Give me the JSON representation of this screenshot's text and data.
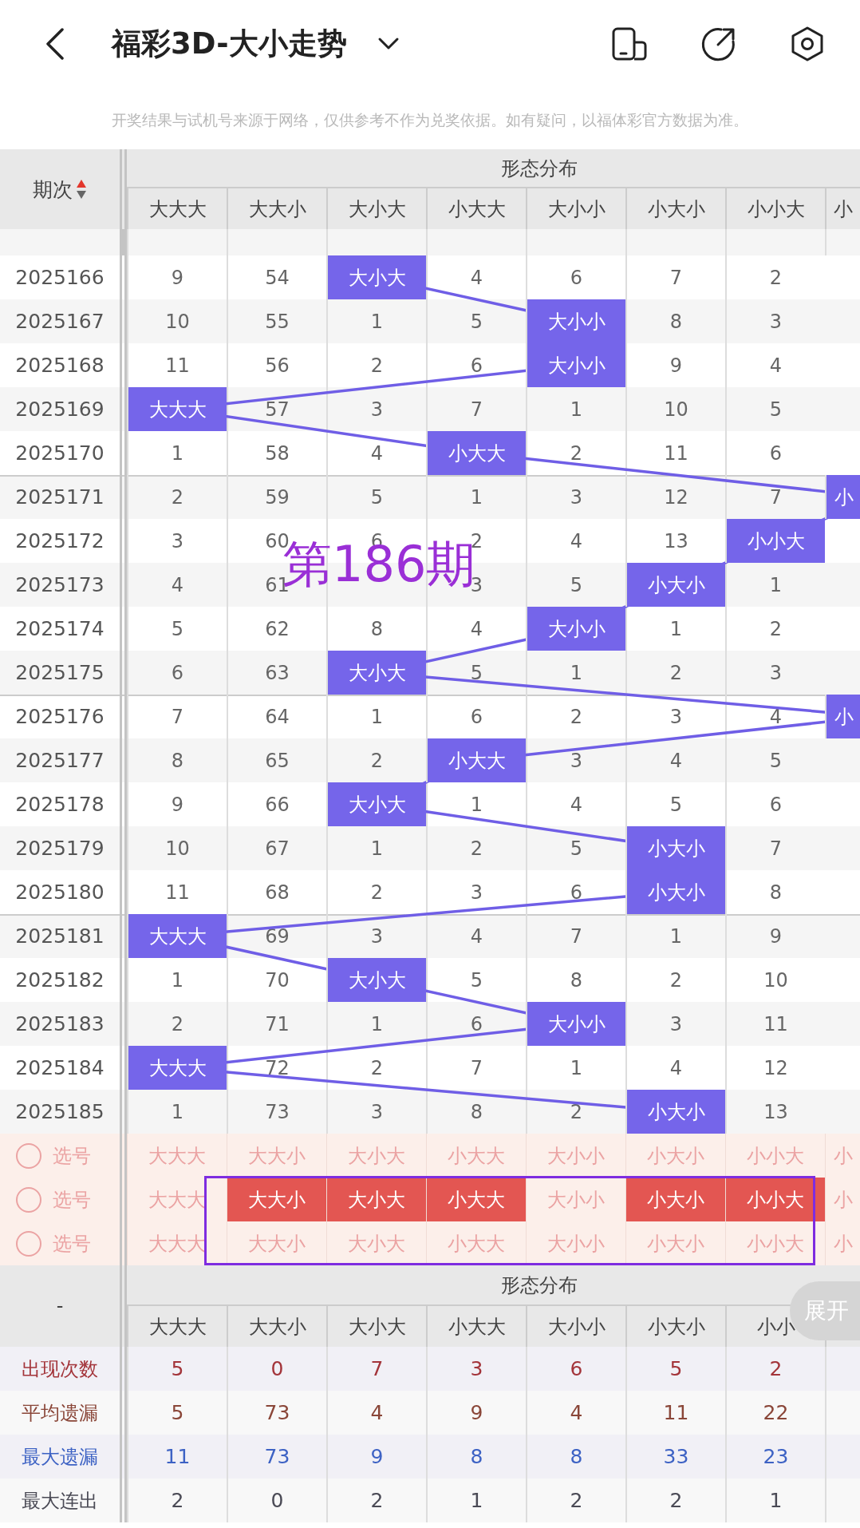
{
  "header": {
    "title": "福彩3D-大小走势"
  },
  "notice": "开奖结果与试机号来源于网络，仅供参考不作为兑奖依据。如有疑问，以福体彩官方数据为准。",
  "table": {
    "period_header": "期次",
    "group_header": "形态分布",
    "columns": [
      "大大大",
      "大大小",
      "大小大",
      "小大大",
      "大小小",
      "小大小",
      "小小大",
      "小"
    ],
    "rows": [
      {
        "period": "2025166",
        "cells": [
          {
            "text": "9",
            "hit": false
          },
          {
            "text": "54",
            "hit": false
          },
          {
            "text": "大小大",
            "hit": true
          },
          {
            "text": "4",
            "hit": false
          },
          {
            "text": "6",
            "hit": false
          },
          {
            "text": "7",
            "hit": false
          },
          {
            "text": "2",
            "hit": false
          }
        ]
      },
      {
        "period": "2025167",
        "cells": [
          {
            "text": "10",
            "hit": false
          },
          {
            "text": "55",
            "hit": false
          },
          {
            "text": "1",
            "hit": false
          },
          {
            "text": "5",
            "hit": false
          },
          {
            "text": "大小小",
            "hit": true
          },
          {
            "text": "8",
            "hit": false
          },
          {
            "text": "3",
            "hit": false
          }
        ]
      },
      {
        "period": "2025168",
        "cells": [
          {
            "text": "11",
            "hit": false
          },
          {
            "text": "56",
            "hit": false
          },
          {
            "text": "2",
            "hit": false
          },
          {
            "text": "6",
            "hit": false
          },
          {
            "text": "大小小",
            "hit": true
          },
          {
            "text": "9",
            "hit": false
          },
          {
            "text": "4",
            "hit": false
          }
        ]
      },
      {
        "period": "2025169",
        "cells": [
          {
            "text": "大大大",
            "hit": true
          },
          {
            "text": "57",
            "hit": false
          },
          {
            "text": "3",
            "hit": false
          },
          {
            "text": "7",
            "hit": false
          },
          {
            "text": "1",
            "hit": false
          },
          {
            "text": "10",
            "hit": false
          },
          {
            "text": "5",
            "hit": false
          }
        ]
      },
      {
        "period": "2025170",
        "cells": [
          {
            "text": "1",
            "hit": false
          },
          {
            "text": "58",
            "hit": false
          },
          {
            "text": "4",
            "hit": false
          },
          {
            "text": "小大大",
            "hit": true
          },
          {
            "text": "2",
            "hit": false
          },
          {
            "text": "11",
            "hit": false
          },
          {
            "text": "6",
            "hit": false
          }
        ]
      },
      {
        "period": "2025171",
        "cells": [
          {
            "text": "2",
            "hit": false
          },
          {
            "text": "59",
            "hit": false
          },
          {
            "text": "5",
            "hit": false
          },
          {
            "text": "1",
            "hit": false
          },
          {
            "text": "3",
            "hit": false
          },
          {
            "text": "12",
            "hit": false
          },
          {
            "text": "7",
            "hit": false
          },
          {
            "text": "小",
            "hit": true
          }
        ]
      },
      {
        "period": "2025172",
        "cells": [
          {
            "text": "3",
            "hit": false
          },
          {
            "text": "60",
            "hit": false
          },
          {
            "text": "6",
            "hit": false
          },
          {
            "text": "2",
            "hit": false
          },
          {
            "text": "4",
            "hit": false
          },
          {
            "text": "13",
            "hit": false
          },
          {
            "text": "小小大",
            "hit": true
          }
        ]
      },
      {
        "period": "2025173",
        "cells": [
          {
            "text": "4",
            "hit": false
          },
          {
            "text": "61",
            "hit": false
          },
          {
            "hit": false
          },
          {
            "text": "3",
            "hit": false
          },
          {
            "text": "5",
            "hit": false
          },
          {
            "text": "小大小",
            "hit": true
          },
          {
            "text": "1",
            "hit": false
          }
        ]
      },
      {
        "period": "2025174",
        "cells": [
          {
            "text": "5",
            "hit": false
          },
          {
            "text": "62",
            "hit": false
          },
          {
            "text": "8",
            "hit": false
          },
          {
            "text": "4",
            "hit": false
          },
          {
            "text": "大小小",
            "hit": true
          },
          {
            "text": "1",
            "hit": false
          },
          {
            "text": "2",
            "hit": false
          }
        ]
      },
      {
        "period": "2025175",
        "cells": [
          {
            "text": "6",
            "hit": false
          },
          {
            "text": "63",
            "hit": false
          },
          {
            "text": "大小大",
            "hit": true
          },
          {
            "text": "5",
            "hit": false
          },
          {
            "text": "1",
            "hit": false
          },
          {
            "text": "2",
            "hit": false
          },
          {
            "text": "3",
            "hit": false
          }
        ]
      },
      {
        "period": "2025176",
        "cells": [
          {
            "text": "7",
            "hit": false
          },
          {
            "text": "64",
            "hit": false
          },
          {
            "text": "1",
            "hit": false
          },
          {
            "text": "6",
            "hit": false
          },
          {
            "text": "2",
            "hit": false
          },
          {
            "text": "3",
            "hit": false
          },
          {
            "text": "4",
            "hit": false
          },
          {
            "text": "小",
            "hit": true
          }
        ]
      },
      {
        "period": "2025177",
        "cells": [
          {
            "text": "8",
            "hit": false
          },
          {
            "text": "65",
            "hit": false
          },
          {
            "text": "2",
            "hit": false
          },
          {
            "text": "小大大",
            "hit": true
          },
          {
            "text": "3",
            "hit": false
          },
          {
            "text": "4",
            "hit": false
          },
          {
            "text": "5",
            "hit": false
          }
        ]
      },
      {
        "period": "2025178",
        "cells": [
          {
            "text": "9",
            "hit": false
          },
          {
            "text": "66",
            "hit": false
          },
          {
            "text": "大小大",
            "hit": true
          },
          {
            "text": "1",
            "hit": false
          },
          {
            "text": "4",
            "hit": false
          },
          {
            "text": "5",
            "hit": false
          },
          {
            "text": "6",
            "hit": false
          }
        ]
      },
      {
        "period": "2025179",
        "cells": [
          {
            "text": "10",
            "hit": false
          },
          {
            "text": "67",
            "hit": false
          },
          {
            "text": "1",
            "hit": false
          },
          {
            "text": "2",
            "hit": false
          },
          {
            "text": "5",
            "hit": false
          },
          {
            "text": "小大小",
            "hit": true
          },
          {
            "text": "7",
            "hit": false
          }
        ]
      },
      {
        "period": "2025180",
        "cells": [
          {
            "text": "11",
            "hit": false
          },
          {
            "text": "68",
            "hit": false
          },
          {
            "text": "2",
            "hit": false
          },
          {
            "text": "3",
            "hit": false
          },
          {
            "text": "6",
            "hit": false
          },
          {
            "text": "小大小",
            "hit": true
          },
          {
            "text": "8",
            "hit": false
          }
        ]
      },
      {
        "period": "2025181",
        "cells": [
          {
            "text": "大大大",
            "hit": true
          },
          {
            "text": "69",
            "hit": false
          },
          {
            "text": "3",
            "hit": false
          },
          {
            "text": "4",
            "hit": false
          },
          {
            "text": "7",
            "hit": false
          },
          {
            "text": "1",
            "hit": false
          },
          {
            "text": "9",
            "hit": false
          }
        ]
      },
      {
        "period": "2025182",
        "cells": [
          {
            "text": "1",
            "hit": false
          },
          {
            "text": "70",
            "hit": false
          },
          {
            "text": "大小大",
            "hit": true
          },
          {
            "text": "5",
            "hit": false
          },
          {
            "text": "8",
            "hit": false
          },
          {
            "text": "2",
            "hit": false
          },
          {
            "text": "10",
            "hit": false
          }
        ]
      },
      {
        "period": "2025183",
        "cells": [
          {
            "text": "2",
            "hit": false
          },
          {
            "text": "71",
            "hit": false
          },
          {
            "text": "1",
            "hit": false
          },
          {
            "text": "6",
            "hit": false
          },
          {
            "text": "大小小",
            "hit": true
          },
          {
            "text": "3",
            "hit": false
          },
          {
            "text": "11",
            "hit": false
          }
        ]
      },
      {
        "period": "2025184",
        "cells": [
          {
            "text": "大大大",
            "hit": true
          },
          {
            "text": "72",
            "hit": false
          },
          {
            "text": "2",
            "hit": false
          },
          {
            "text": "7",
            "hit": false
          },
          {
            "text": "1",
            "hit": false
          },
          {
            "text": "4",
            "hit": false
          },
          {
            "text": "12",
            "hit": false
          }
        ]
      },
      {
        "period": "2025185",
        "cells": [
          {
            "text": "1",
            "hit": false
          },
          {
            "text": "73",
            "hit": false
          },
          {
            "text": "3",
            "hit": false
          },
          {
            "text": "8",
            "hit": false
          },
          {
            "text": "2",
            "hit": false
          },
          {
            "text": "小大小",
            "hit": true
          },
          {
            "text": "13",
            "hit": false
          }
        ]
      }
    ]
  },
  "annotation": {
    "text": "第186期"
  },
  "picks": [
    {
      "label": "选号",
      "checked": false,
      "options": [
        {
          "text": "大大大",
          "selected": false
        },
        {
          "text": "大大小",
          "selected": false
        },
        {
          "text": "大小大",
          "selected": false
        },
        {
          "text": "小大大",
          "selected": false
        },
        {
          "text": "大小小",
          "selected": false
        },
        {
          "text": "小大小",
          "selected": false
        },
        {
          "text": "小小大",
          "selected": false
        },
        {
          "text": "小",
          "selected": false
        }
      ]
    },
    {
      "label": "选号",
      "checked": false,
      "options": [
        {
          "text": "大大大",
          "selected": false
        },
        {
          "text": "大大小",
          "selected": true
        },
        {
          "text": "大小大",
          "selected": true
        },
        {
          "text": "小大大",
          "selected": true
        },
        {
          "text": "大小小",
          "selected": false
        },
        {
          "text": "小大小",
          "selected": true
        },
        {
          "text": "小小大",
          "selected": true
        },
        {
          "text": "小",
          "selected": false
        }
      ]
    },
    {
      "label": "选号",
      "checked": false,
      "options": [
        {
          "text": "大大大",
          "selected": false
        },
        {
          "text": "大大小",
          "selected": false
        },
        {
          "text": "大小大",
          "selected": false
        },
        {
          "text": "小大大",
          "selected": false
        },
        {
          "text": "大小小",
          "selected": false
        },
        {
          "text": "小大小",
          "selected": false
        },
        {
          "text": "小小大",
          "selected": false
        },
        {
          "text": "小",
          "selected": false
        }
      ]
    }
  ],
  "stats": {
    "corner": "-",
    "group_header": "形态分布",
    "columns": [
      "大大大",
      "大大小",
      "大小大",
      "小大大",
      "大小小",
      "小大小",
      "小小"
    ],
    "rows": [
      {
        "label": "出现次数",
        "color": "#a3343a",
        "values": [
          "5",
          "0",
          "7",
          "3",
          "6",
          "5",
          "2"
        ]
      },
      {
        "label": "平均遗漏",
        "color": "#8a4638",
        "values": [
          "5",
          "73",
          "4",
          "9",
          "4",
          "11",
          "22"
        ]
      },
      {
        "label": "最大遗漏",
        "color": "#3d62c4",
        "values": [
          "11",
          "73",
          "9",
          "8",
          "8",
          "33",
          "23"
        ]
      },
      {
        "label": "最大连出",
        "color": "#4a4a55",
        "values": [
          "2",
          "0",
          "2",
          "1",
          "2",
          "2",
          "1"
        ]
      }
    ]
  },
  "expand_button": "展开"
}
